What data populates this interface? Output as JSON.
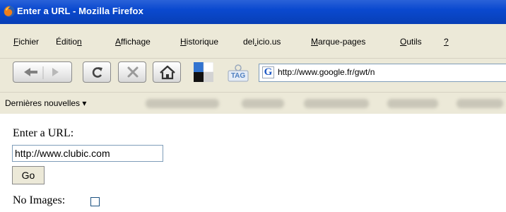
{
  "window": {
    "title": "Enter a URL - Mozilla Firefox"
  },
  "menu": {
    "items": [
      {
        "pre": "",
        "u": "F",
        "post": "ichier"
      },
      {
        "pre": "Éditio",
        "u": "n",
        "post": ""
      },
      {
        "pre": "",
        "u": "A",
        "post": "ffichage"
      },
      {
        "pre": "",
        "u": "H",
        "post": "istorique"
      },
      {
        "pre": "del",
        "u": ".",
        "post": "icio.us"
      },
      {
        "pre": "",
        "u": "M",
        "post": "arque-pages"
      },
      {
        "pre": "",
        "u": "O",
        "post": "utils"
      },
      {
        "pre": "",
        "u": "?",
        "post": ""
      }
    ]
  },
  "toolbar": {
    "tag_label": "TAG",
    "url": "http://www.google.fr/gwt/n",
    "favicon_letter": "G"
  },
  "bookmarks": {
    "label": "Dernières nouvelles ▾"
  },
  "page": {
    "url_label": "Enter a URL:",
    "url_value": "http://www.clubic.com",
    "go_label": "Go",
    "no_images_label": "No Images:"
  },
  "icons": {
    "app": "firefox-icon",
    "back_forward": "back-forward-icon",
    "reload": "reload-icon",
    "stop": "stop-icon",
    "home": "home-icon",
    "delicious": "delicious-icon",
    "tag": "tag-icon",
    "site": "google-favicon"
  }
}
